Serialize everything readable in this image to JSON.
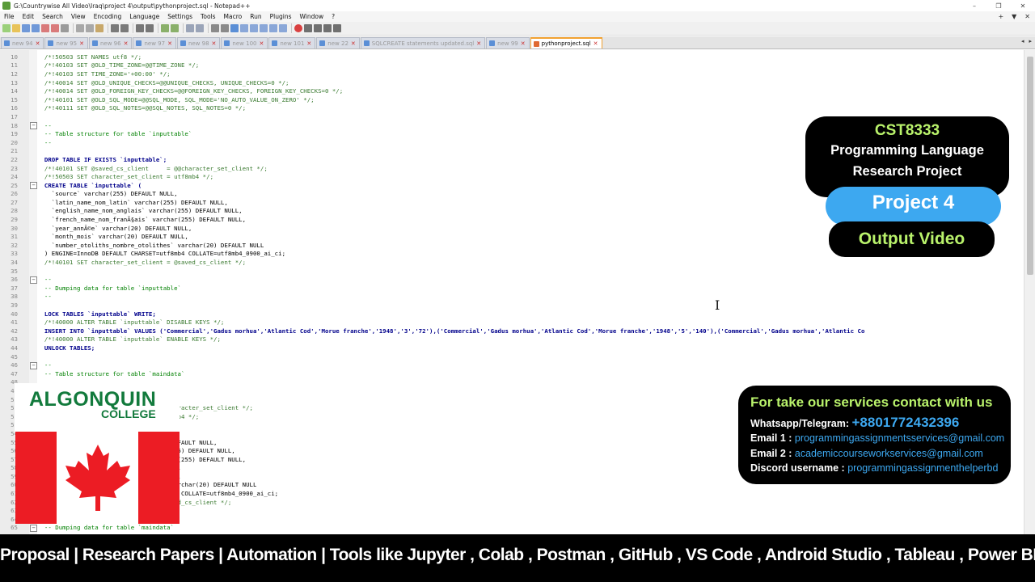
{
  "window": {
    "title": "G:\\Countrywise All Video\\Iraq\\project 4\\output\\pythonproject.sql - Notepad++",
    "controls": [
      "–",
      "❐",
      "✕"
    ]
  },
  "menu": {
    "items": [
      "File",
      "Edit",
      "Search",
      "View",
      "Encoding",
      "Language",
      "Settings",
      "Tools",
      "Macro",
      "Run",
      "Plugins",
      "Window",
      "?"
    ],
    "right": [
      "+",
      "▼",
      "✕"
    ]
  },
  "tabs": [
    {
      "label": "new 94",
      "active": false
    },
    {
      "label": "new 95",
      "active": false
    },
    {
      "label": "new 96",
      "active": false
    },
    {
      "label": "new 97",
      "active": false
    },
    {
      "label": "new 98",
      "active": false
    },
    {
      "label": "new 100",
      "active": false
    },
    {
      "label": "new 101",
      "active": false
    },
    {
      "label": "new 22",
      "active": false
    },
    {
      "label": "SQLCREATE statements updated.sql",
      "active": false
    },
    {
      "label": "new 99",
      "active": false
    },
    {
      "label": "pythonproject.sql",
      "active": true
    }
  ],
  "tab_arrows": [
    "◂",
    "▸"
  ],
  "code_lines": [
    {
      "n": "10",
      "t": "  /*!50503 SET NAMES utf8 */;",
      "c": "cond"
    },
    {
      "n": "11",
      "t": "  /*!40103 SET @OLD_TIME_ZONE=@@TIME_ZONE */;",
      "c": "cond"
    },
    {
      "n": "12",
      "t": "  /*!40103 SET TIME_ZONE='+00:00' */;",
      "c": "cond"
    },
    {
      "n": "13",
      "t": "  /*!40014 SET @OLD_UNIQUE_CHECKS=@@UNIQUE_CHECKS, UNIQUE_CHECKS=0 */;",
      "c": "cond"
    },
    {
      "n": "14",
      "t": "  /*!40014 SET @OLD_FOREIGN_KEY_CHECKS=@@FOREIGN_KEY_CHECKS, FOREIGN_KEY_CHECKS=0 */;",
      "c": "cond"
    },
    {
      "n": "15",
      "t": "  /*!40101 SET @OLD_SQL_MODE=@@SQL_MODE, SQL_MODE='NO_AUTO_VALUE_ON_ZERO' */;",
      "c": "cond"
    },
    {
      "n": "16",
      "t": "  /*!40111 SET @OLD_SQL_NOTES=@@SQL_NOTES, SQL_NOTES=0 */;",
      "c": "cond"
    },
    {
      "n": "17",
      "t": "",
      "c": "plain"
    },
    {
      "n": "18",
      "t": "  --",
      "c": "comment",
      "fold": true
    },
    {
      "n": "19",
      "t": "  -- Table structure for table `inputtable`",
      "c": "comment"
    },
    {
      "n": "20",
      "t": "  --",
      "c": "comment"
    },
    {
      "n": "21",
      "t": "",
      "c": "plain"
    },
    {
      "n": "22",
      "t": "  DROP TABLE IF EXISTS `inputtable`;",
      "c": "kw"
    },
    {
      "n": "23",
      "t": "  /*!40101 SET @saved_cs_client     = @@character_set_client */;",
      "c": "cond"
    },
    {
      "n": "24",
      "t": "  /*!50503 SET character_set_client = utf8mb4 */;",
      "c": "cond"
    },
    {
      "n": "25",
      "t": "  CREATE TABLE `inputtable` (",
      "c": "kw",
      "fold": true
    },
    {
      "n": "26",
      "t": "    `source` varchar(255) DEFAULT NULL,",
      "c": "plain"
    },
    {
      "n": "27",
      "t": "    `latin_name_nom_latin` varchar(255) DEFAULT NULL,",
      "c": "plain"
    },
    {
      "n": "28",
      "t": "    `english_name_nom_anglais` varchar(255) DEFAULT NULL,",
      "c": "plain"
    },
    {
      "n": "29",
      "t": "    `french_name_nom_franÃ§ais` varchar(255) DEFAULT NULL,",
      "c": "plain"
    },
    {
      "n": "30",
      "t": "    `year_annÃ©e` varchar(20) DEFAULT NULL,",
      "c": "plain"
    },
    {
      "n": "31",
      "t": "    `month_mois` varchar(20) DEFAULT NULL,",
      "c": "plain"
    },
    {
      "n": "32",
      "t": "    `number_otoliths_nombre_otolithes` varchar(20) DEFAULT NULL",
      "c": "plain"
    },
    {
      "n": "33",
      "t": "  ) ENGINE=InnoDB DEFAULT CHARSET=utf8mb4 COLLATE=utf8mb4_0900_ai_ci;",
      "c": "plain"
    },
    {
      "n": "34",
      "t": "  /*!40101 SET character_set_client = @saved_cs_client */;",
      "c": "cond"
    },
    {
      "n": "35",
      "t": "",
      "c": "plain"
    },
    {
      "n": "36",
      "t": "  --",
      "c": "comment",
      "fold": true
    },
    {
      "n": "37",
      "t": "  -- Dumping data for table `inputtable`",
      "c": "comment"
    },
    {
      "n": "38",
      "t": "  --",
      "c": "comment"
    },
    {
      "n": "39",
      "t": "",
      "c": "plain"
    },
    {
      "n": "40",
      "t": "  LOCK TABLES `inputtable` WRITE;",
      "c": "kw"
    },
    {
      "n": "41",
      "t": "  /*!40000 ALTER TABLE `inputtable` DISABLE KEYS */;",
      "c": "cond"
    },
    {
      "n": "42",
      "t": "  INSERT INTO `inputtable` VALUES ('Commercial','Gadus morhua','Atlantic Cod','Morue franche','1948','3','72'),('Commercial','Gadus morhua','Atlantic Cod','Morue franche','1948','5','140'),('Commercial','Gadus morhua','Atlantic Co",
      "c": "kw"
    },
    {
      "n": "43",
      "t": "  /*!40000 ALTER TABLE `inputtable` ENABLE KEYS */;",
      "c": "cond"
    },
    {
      "n": "44",
      "t": "  UNLOCK TABLES;",
      "c": "kw"
    },
    {
      "n": "45",
      "t": "",
      "c": "plain"
    },
    {
      "n": "46",
      "t": "  --",
      "c": "comment",
      "fold": true
    },
    {
      "n": "47",
      "t": "  -- Table structure for table `maindata`",
      "c": "comment"
    },
    {
      "n": "48",
      "t": "",
      "c": "plain"
    },
    {
      "n": "49",
      "t": "",
      "c": "plain"
    },
    {
      "n": "50",
      "t": "",
      "c": "plain"
    },
    {
      "n": "51",
      "t": "                                = @@character_set_client */;",
      "c": "cond"
    },
    {
      "n": "52",
      "t": "                                = utf8mb4 */;",
      "c": "cond"
    },
    {
      "n": "53",
      "t": "",
      "c": "plain"
    },
    {
      "n": "54",
      "t": "                                ULL,",
      "c": "plain"
    },
    {
      "n": "55",
      "t": "                                255) DEFAULT NULL,",
      "c": "plain"
    },
    {
      "n": "56",
      "t": "                                char(255) DEFAULT NULL,",
      "c": "plain"
    },
    {
      "n": "57",
      "t": "                                varchar(255) DEFAULT NULL,",
      "c": "plain"
    },
    {
      "n": "58",
      "t": "                                LT NULL,",
      "c": "plain"
    },
    {
      "n": "59",
      "t": "                                LT NULL,",
      "c": "plain"
    },
    {
      "n": "60",
      "t": "                                hes` varchar(20) DEFAULT NULL",
      "c": "plain"
    },
    {
      "n": "61",
      "t": "                                utf8mb4 COLLATE=utf8mb4_0900_ai_ci;",
      "c": "plain"
    },
    {
      "n": "62",
      "t": "                                = @saved_cs_client */;",
      "c": "cond"
    },
    {
      "n": "63",
      "t": "",
      "c": "plain"
    },
    {
      "n": "64",
      "t": "",
      "c": "plain"
    },
    {
      "n": "65",
      "t": "  -- Dumping data for table `maindata`",
      "c": "comment",
      "fold": true
    }
  ],
  "overlay": {
    "course": "CST8333",
    "course_sub_1": "Programming Language",
    "course_sub_2": "Research Project",
    "project": "Project 4",
    "output": "Output Video",
    "college_name": "ALGONQUIN",
    "college_sub": "COLLEGE",
    "contact": {
      "heading": "For take our services contact with us",
      "whatsapp_label": "Whatsapp/Telegram:",
      "whatsapp": "+8801772432396",
      "email1_label": "Email 1 :",
      "email1": "programmingassignmentsservices@gmail.com",
      "email2_label": "Email 2 :",
      "email2": "academiccourseworkservices@gmail.com",
      "discord_label": "Discord username :",
      "discord": "programmingassignmenthelperbd"
    },
    "ticker": "Proposal | Research Papers | Automation | Tools like  Jupyter , Colab ,  Postman , GitHub ,  VS Code ,  Android Studio ,  Tableau  ,  Power BI"
  },
  "colors": {
    "accent_green": "#b9f26b",
    "accent_blue": "#3da8f0",
    "college_green": "#127a3c",
    "flag_red": "#ec1c24",
    "active_tab": "#f2a232"
  }
}
